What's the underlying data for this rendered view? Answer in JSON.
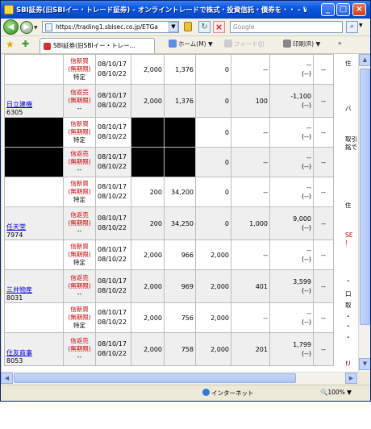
{
  "window": {
    "title": "SBI証券(旧SBIイー・トレード証券) - オンライントレードで株式・投資信託・債券を・・ - Win..."
  },
  "toolbar": {
    "url": "https://trading1.sbisec.co.jp/ETGa",
    "search_placeholder": "Google"
  },
  "tab": {
    "label": "SBI証券(旧SBIイー・トレー..."
  },
  "commands": {
    "home": "ホーム(M)",
    "feed": "フィード(J)",
    "print": "印刷(R)"
  },
  "rows": [
    {
      "name": "",
      "code": "",
      "type": [
        "信新買",
        "(無期限)",
        "特定"
      ],
      "order": "08/10/17",
      "settle": "08/10/22",
      "qty": "2,000",
      "price": "1,376",
      "done": "0",
      "pos": "--",
      "pl": [
        "--",
        "(--)"
      ],
      "x": "--",
      "gray": false,
      "redact": false
    },
    {
      "name": "日立建機",
      "code": "6305",
      "type": [
        "信返売",
        "(無期限)",
        "--"
      ],
      "order": "08/10/17",
      "settle": "08/10/22",
      "qty": "2,000",
      "price": "1,376",
      "done": "0",
      "pos": "100",
      "pl": [
        "-1,100",
        "(--)"
      ],
      "x": "--",
      "gray": true,
      "redact": false
    },
    {
      "name": "",
      "code": "",
      "type": [
        "信新買",
        "(無期限)",
        "特定"
      ],
      "order": "08/10/17",
      "settle": "08/10/22",
      "qty": "",
      "price": "",
      "done": "0",
      "pos": "--",
      "pl": [
        "--",
        "(--)"
      ],
      "x": "--",
      "gray": false,
      "redact": true
    },
    {
      "name": "",
      "code": "",
      "type": [
        "信返売",
        "(無期限)",
        "--"
      ],
      "order": "08/10/17",
      "settle": "08/10/22",
      "qty": "",
      "price": "",
      "done": "0",
      "pos": "--",
      "pl": [
        "--",
        "(--)"
      ],
      "x": "--",
      "gray": true,
      "redact": true
    },
    {
      "name": "",
      "code": "",
      "type": [
        "信新買",
        "(無期限)",
        "特定"
      ],
      "order": "08/10/17",
      "settle": "08/10/22",
      "qty": "200",
      "price": "34,200",
      "done": "0",
      "pos": "--",
      "pl": [
        "--",
        "(--)"
      ],
      "x": "--",
      "gray": false,
      "redact": false
    },
    {
      "name": "任天堂",
      "code": "7974",
      "type": [
        "信返売",
        "(無期限)",
        "--"
      ],
      "order": "08/10/17",
      "settle": "08/10/22",
      "qty": "200",
      "price": "34,250",
      "done": "0",
      "pos": "1,000",
      "pl": [
        "9,000",
        "(--)"
      ],
      "x": "--",
      "gray": true,
      "redact": false
    },
    {
      "name": "",
      "code": "",
      "type": [
        "信新買",
        "(無期限)",
        "特定"
      ],
      "order": "08/10/17",
      "settle": "08/10/22",
      "qty": "2,000",
      "price": "966",
      "done": "2,000",
      "pos": "--",
      "pl": [
        "--",
        "(--)"
      ],
      "x": "--",
      "gray": false,
      "redact": false
    },
    {
      "name": "三井物産",
      "code": "8031",
      "type": [
        "信返売",
        "(無期限)",
        "--"
      ],
      "order": "08/10/17",
      "settle": "08/10/22",
      "qty": "2,000",
      "price": "969",
      "done": "2,000",
      "pos": "401",
      "pl": [
        "3,599",
        "(--)"
      ],
      "x": "--",
      "gray": true,
      "redact": false
    },
    {
      "name": "",
      "code": "",
      "type": [
        "信新買",
        "(無期限)",
        "特定"
      ],
      "order": "08/10/17",
      "settle": "08/10/22",
      "qty": "2,000",
      "price": "756",
      "done": "2,000",
      "pos": "--",
      "pl": [
        "--",
        "(--)"
      ],
      "x": "--",
      "gray": false,
      "redact": false
    },
    {
      "name": "住友商事",
      "code": "8053",
      "type": [
        "信返売",
        "(無期限)",
        "--"
      ],
      "order": "08/10/17",
      "settle": "08/10/22",
      "qty": "2,000",
      "price": "758",
      "done": "2,000",
      "pos": "201",
      "pl": [
        "1,799",
        "(--)"
      ],
      "x": "--",
      "gray": true,
      "redact": false
    }
  ],
  "sidebar": {
    "items": [
      "住",
      "",
      "バ",
      "取引",
      "銘で",
      "",
      "住",
      "SE",
      "!",
      "・",
      "口",
      "取",
      "・",
      "・",
      "・",
      "!",
      "・",
      "リ"
    ]
  },
  "status": {
    "zone": "インターネット",
    "zoom": "100%"
  },
  "colors": {
    "link": "#0000cc",
    "red_text": "#cc0000",
    "titlebar": "#0a58e0"
  }
}
